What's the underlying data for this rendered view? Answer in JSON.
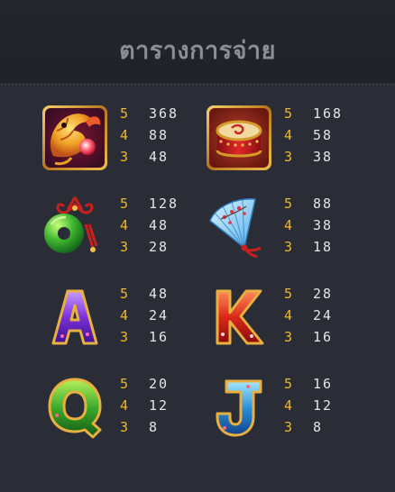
{
  "header": {
    "title": "ตารางการจ่าย"
  },
  "colors": {
    "background": "#2b2d36",
    "header_background": "#202228",
    "title": "#8b8e99",
    "count_accent": "#f1b826",
    "value": "#e4e5ea"
  },
  "paytable": [
    {
      "symbol_icon": "golden-carp-icon",
      "rows": [
        {
          "count": "5",
          "value": "368"
        },
        {
          "count": "4",
          "value": "88"
        },
        {
          "count": "3",
          "value": "48"
        }
      ]
    },
    {
      "symbol_icon": "red-drum-icon",
      "rows": [
        {
          "count": "5",
          "value": "168"
        },
        {
          "count": "4",
          "value": "58"
        },
        {
          "count": "3",
          "value": "38"
        }
      ]
    },
    {
      "symbol_icon": "jade-pendant-icon",
      "rows": [
        {
          "count": "5",
          "value": "128"
        },
        {
          "count": "4",
          "value": "48"
        },
        {
          "count": "3",
          "value": "28"
        }
      ]
    },
    {
      "symbol_icon": "folding-fan-icon",
      "rows": [
        {
          "count": "5",
          "value": "88"
        },
        {
          "count": "4",
          "value": "38"
        },
        {
          "count": "3",
          "value": "18"
        }
      ]
    },
    {
      "symbol_icon": "letter-a-icon",
      "rows": [
        {
          "count": "5",
          "value": "48"
        },
        {
          "count": "4",
          "value": "24"
        },
        {
          "count": "3",
          "value": "16"
        }
      ]
    },
    {
      "symbol_icon": "letter-k-icon",
      "rows": [
        {
          "count": "5",
          "value": "28"
        },
        {
          "count": "4",
          "value": "24"
        },
        {
          "count": "3",
          "value": "16"
        }
      ]
    },
    {
      "symbol_icon": "letter-q-icon",
      "rows": [
        {
          "count": "5",
          "value": "20"
        },
        {
          "count": "4",
          "value": "12"
        },
        {
          "count": "3",
          "value": "8"
        }
      ]
    },
    {
      "symbol_icon": "letter-j-icon",
      "rows": [
        {
          "count": "5",
          "value": "16"
        },
        {
          "count": "4",
          "value": "12"
        },
        {
          "count": "3",
          "value": "8"
        }
      ]
    }
  ]
}
